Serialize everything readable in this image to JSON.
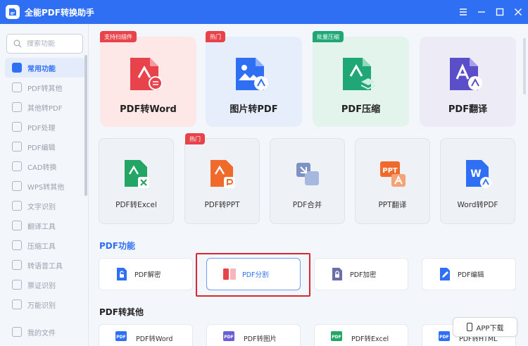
{
  "app": {
    "title": "全能PDF转换助手"
  },
  "sidebar": {
    "search_placeholder": "搜索功能",
    "items": [
      {
        "label": "常用功能"
      },
      {
        "label": "PDF转其他"
      },
      {
        "label": "其他转PDF"
      },
      {
        "label": "PDF处理"
      },
      {
        "label": "PDF编辑"
      },
      {
        "label": "CAD转换"
      },
      {
        "label": "WPS转其他"
      },
      {
        "label": "文字识别"
      },
      {
        "label": "翻译工具"
      },
      {
        "label": "压缩工具"
      },
      {
        "label": "转语音工具"
      },
      {
        "label": "票证识别"
      },
      {
        "label": "万能识别"
      }
    ],
    "bottom_item": {
      "label": "我的文件"
    }
  },
  "featured": [
    {
      "label": "PDF转Word",
      "tag": "支持扫描件",
      "tag_color": "#e8424b",
      "bg": "#fde7e7",
      "icon_color": "#e8424b",
      "icon": "pdf-to-word-icon"
    },
    {
      "label": "图片转PDF",
      "tag": "热门",
      "tag_color": "#e8424b",
      "bg": "#e6eefc",
      "icon_color": "#2f6ff4",
      "icon": "image-to-pdf-icon"
    },
    {
      "label": "PDF压缩",
      "tag": "批量压缩",
      "tag_color": "#1fa876",
      "bg": "#e2f4ec",
      "icon_color": "#1fa876",
      "icon": "pdf-compress-icon"
    },
    {
      "label": "PDF翻译",
      "tag": "",
      "tag_color": "",
      "bg": "#ecebf6",
      "icon_color": "#5b4ec9",
      "icon": "pdf-translate-icon"
    }
  ],
  "tools": [
    {
      "label": "PDF转Excel",
      "tag": "",
      "icon_color": "#22a565",
      "letter": "X"
    },
    {
      "label": "PDF转PPT",
      "tag": "热门",
      "icon_color": "#ef6a2b",
      "letter": "P"
    },
    {
      "label": "PDF合并",
      "tag": "",
      "icon_color": "#5f7bb6",
      "letter": "+"
    },
    {
      "label": "PPT翻译",
      "tag": "",
      "icon_color": "#ef6a2b",
      "letter": "A"
    },
    {
      "label": "Word转PDF",
      "tag": "",
      "icon_color": "#2f6ff4",
      "letter": "W"
    }
  ],
  "pdf_functions": {
    "title": "PDF功能",
    "items": [
      {
        "label": "PDF解密",
        "icon_color": "#2f6ff4"
      },
      {
        "label": "PDF分割",
        "icon_color": "#e8424b"
      },
      {
        "label": "PDF加密",
        "icon_color": "#6b6fa8"
      },
      {
        "label": "PDF编辑",
        "icon_color": "#2f6ff4"
      }
    ]
  },
  "pdf_to_other": {
    "title": "PDF转其他",
    "items": [
      {
        "label": "PDF转Word",
        "icon_color": "#2f6ff4"
      },
      {
        "label": "PDF转图片",
        "icon_color": "#6b5fd8"
      },
      {
        "label": "PDF转Excel",
        "icon_color": "#22a565"
      },
      {
        "label": "PDF转HTML",
        "icon_color": "#2f6ff4"
      }
    ]
  },
  "app_download": {
    "label": "APP下载"
  },
  "colors": {
    "primary": "#2f6ff4",
    "highlight": "#d7282f"
  }
}
